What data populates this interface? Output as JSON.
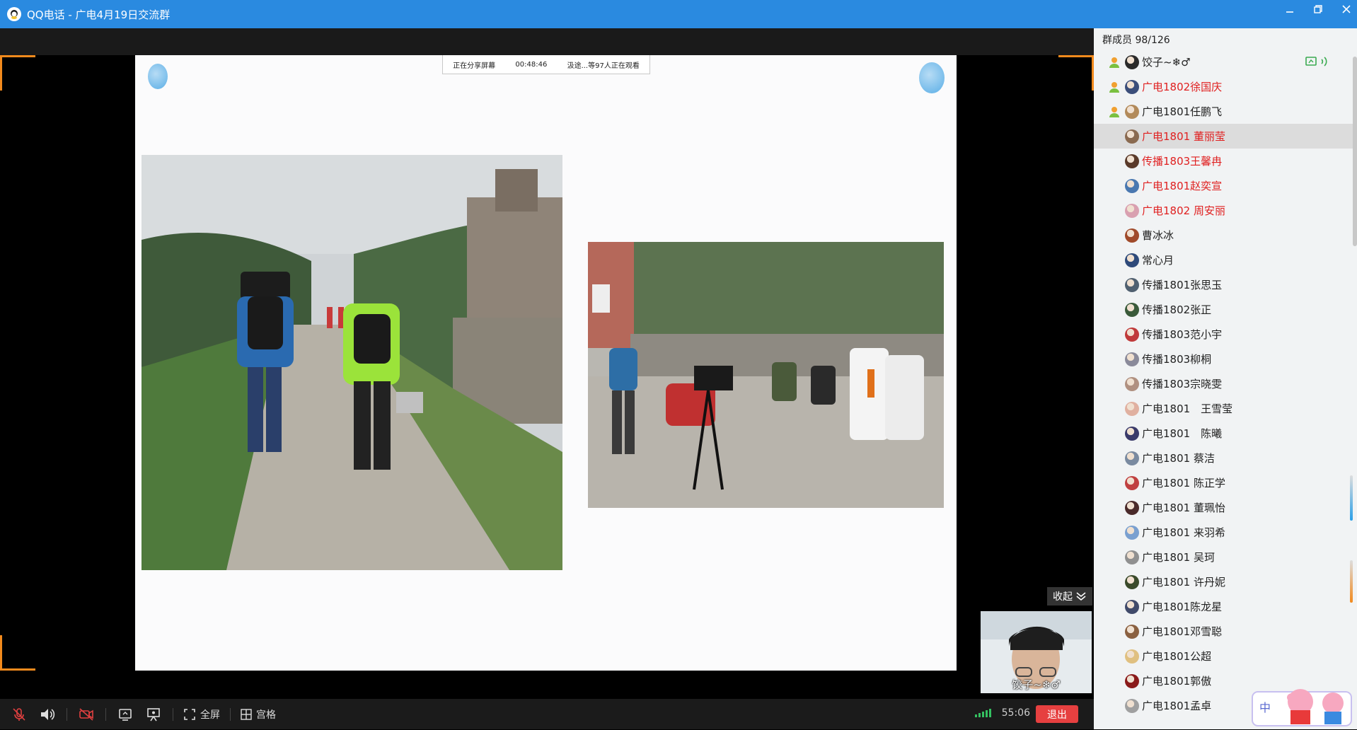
{
  "window": {
    "title": "QQ电话 - 广电4月19日交流群",
    "controls": [
      "minimize",
      "restore",
      "close"
    ]
  },
  "share_banner": {
    "status": "正在分享屏幕",
    "elapsed": "00:48:46",
    "viewers": "汲途...等97人正在观看"
  },
  "video_tile": {
    "collapse_label": "收起",
    "name": "饺子~❄♂"
  },
  "toolbar": {
    "fullscreen_label": "全屏",
    "grid_label": "宫格",
    "call_time": "55:06",
    "exit_label": "退出"
  },
  "members": {
    "count_label": "群成员 98/126",
    "list": [
      {
        "name": "饺子~❄♂",
        "mic": true,
        "speaking": true,
        "red": false,
        "avatar": "#2a2a2a"
      },
      {
        "name": "广电1802徐国庆",
        "mic": true,
        "speaking": false,
        "red": true,
        "avatar": "#3b4e7a"
      },
      {
        "name": "广电1801任鹏飞",
        "mic": true,
        "speaking": false,
        "red": false,
        "avatar": "#b28a5a"
      },
      {
        "name": "广电1801 董丽莹",
        "mic": false,
        "speaking": false,
        "red": true,
        "avatar": "#8a6a50",
        "selected": true
      },
      {
        "name": "传播1803王馨冉",
        "mic": false,
        "speaking": false,
        "red": true,
        "avatar": "#5a3a2a"
      },
      {
        "name": "广电1801赵奕宣",
        "mic": false,
        "speaking": false,
        "red": true,
        "avatar": "#4a78b0"
      },
      {
        "name": "广电1802 周安丽",
        "mic": false,
        "speaking": false,
        "red": true,
        "avatar": "#d9a0b0"
      },
      {
        "name": "曹冰冰",
        "mic": false,
        "speaking": false,
        "red": false,
        "avatar": "#a04a2a"
      },
      {
        "name": "常心月",
        "mic": false,
        "speaking": false,
        "red": false,
        "avatar": "#2e4a7a"
      },
      {
        "name": "传播1801张思玉",
        "mic": false,
        "speaking": false,
        "red": false,
        "avatar": "#506070"
      },
      {
        "name": "传播1802张正",
        "mic": false,
        "speaking": false,
        "red": false,
        "avatar": "#3a5a3a"
      },
      {
        "name": "传播1803范小宇",
        "mic": false,
        "speaking": false,
        "red": false,
        "avatar": "#c03a3a"
      },
      {
        "name": "传播1803柳桐",
        "mic": false,
        "speaking": false,
        "red": false,
        "avatar": "#8a8a9a"
      },
      {
        "name": "传播1803宗晓雯",
        "mic": false,
        "speaking": false,
        "red": false,
        "avatar": "#b09080"
      },
      {
        "name": "广电1801　王雪莹",
        "mic": false,
        "speaking": false,
        "red": false,
        "avatar": "#e0b0a0"
      },
      {
        "name": "广电1801　陈曦",
        "mic": false,
        "speaking": false,
        "red": false,
        "avatar": "#3a3a6a"
      },
      {
        "name": "广电1801 蔡洁",
        "mic": false,
        "speaking": false,
        "red": false,
        "avatar": "#7a8aa0"
      },
      {
        "name": "广电1801 陈正学",
        "mic": false,
        "speaking": false,
        "red": false,
        "avatar": "#c04040"
      },
      {
        "name": "广电1801 董珮怡",
        "mic": false,
        "speaking": false,
        "red": false,
        "avatar": "#4a2a2a"
      },
      {
        "name": "广电1801 来羽希",
        "mic": false,
        "speaking": false,
        "red": false,
        "avatar": "#7aa0d0"
      },
      {
        "name": "广电1801 吴珂",
        "mic": false,
        "speaking": false,
        "red": false,
        "avatar": "#909090"
      },
      {
        "name": "广电1801 许丹妮",
        "mic": false,
        "speaking": false,
        "red": false,
        "avatar": "#3a4a2a"
      },
      {
        "name": "广电1801陈龙星",
        "mic": false,
        "speaking": false,
        "red": false,
        "avatar": "#404a6a"
      },
      {
        "name": "广电1801邓雪聪",
        "mic": false,
        "speaking": false,
        "red": false,
        "avatar": "#8a6040"
      },
      {
        "name": "广电1801公超",
        "mic": false,
        "speaking": false,
        "red": false,
        "avatar": "#e0c080"
      },
      {
        "name": "广电1801郭傲",
        "mic": false,
        "speaking": false,
        "red": false,
        "avatar": "#8a1a1a"
      },
      {
        "name": "广电1801孟卓",
        "mic": false,
        "speaking": false,
        "red": false,
        "avatar": "#a0a0a0"
      }
    ]
  },
  "colors": {
    "titlebar": "#2a8ae0",
    "accent_orange": "#f28a1d",
    "exit_red": "#e64040",
    "member_red": "#e02020"
  }
}
